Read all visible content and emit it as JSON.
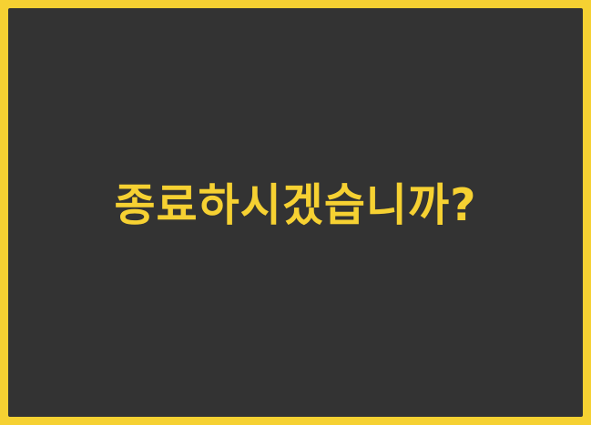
{
  "dialog": {
    "message": "종료하시겠습니까?"
  },
  "colors": {
    "frame": "#f6d132",
    "background": "#333333",
    "text": "#f6d132"
  }
}
